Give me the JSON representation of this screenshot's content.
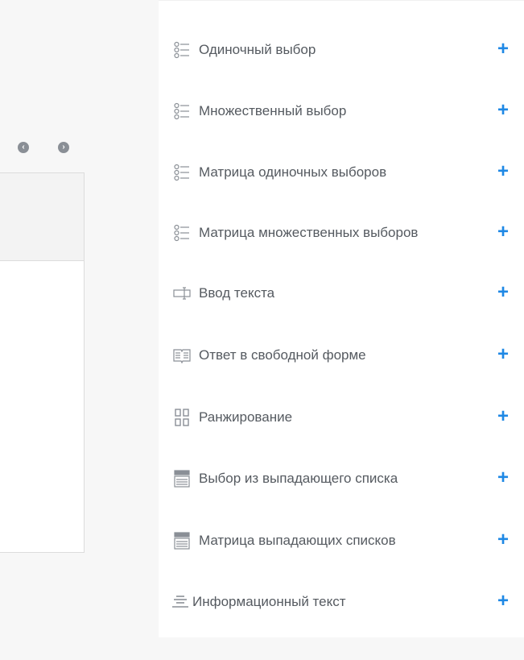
{
  "colors": {
    "accent": "#1e88e5",
    "text": "#555a60",
    "icon": "#8a8f96"
  },
  "nav": {
    "prev_icon": "arrow-left-circle-icon",
    "next_icon": "arrow-right-circle-icon",
    "prev_glyph": "‹",
    "next_glyph": "›"
  },
  "question_types": [
    {
      "label": "Одиночный выбор",
      "icon": "single-choice-icon",
      "add_glyph": "+"
    },
    {
      "label": "Множественный выбор",
      "icon": "multiple-choice-icon",
      "add_glyph": "+"
    },
    {
      "label": "Матрица одиночных выборов",
      "icon": "matrix-single-icon",
      "add_glyph": "+"
    },
    {
      "label": "Матрица множественных выборов",
      "icon": "matrix-multiple-icon",
      "add_glyph": "+"
    },
    {
      "label": "Ввод текста",
      "icon": "text-input-icon",
      "add_glyph": "+"
    },
    {
      "label": "Ответ в свободной форме",
      "icon": "free-form-icon",
      "add_glyph": "+"
    },
    {
      "label": "Ранжирование",
      "icon": "ranking-icon",
      "add_glyph": "+"
    },
    {
      "label": "Выбор из выпадающего списка",
      "icon": "dropdown-icon",
      "add_glyph": "+"
    },
    {
      "label": "Матрица выпадающих списков",
      "icon": "matrix-dropdown-icon",
      "add_glyph": "+"
    },
    {
      "label": "Информационный текст",
      "icon": "info-text-icon",
      "add_glyph": "+"
    }
  ]
}
